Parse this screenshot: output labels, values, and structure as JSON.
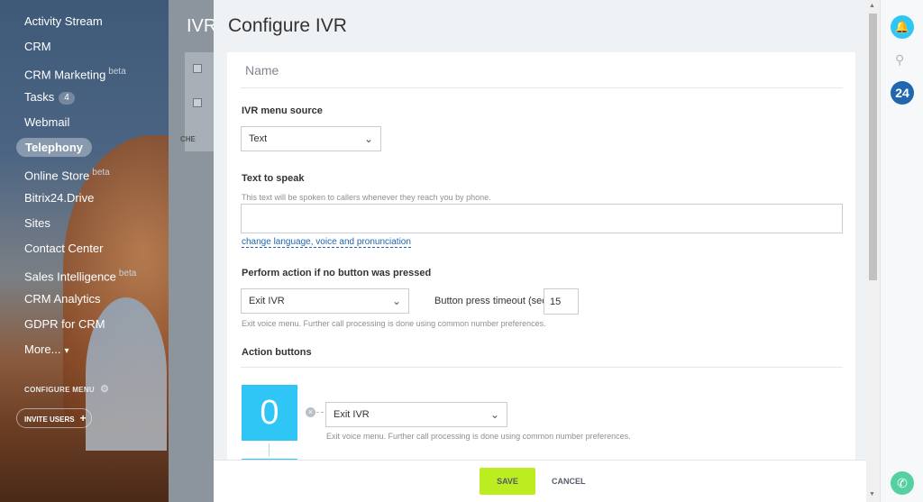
{
  "sidebar": {
    "items": [
      {
        "label": "Activity Stream",
        "beta": "",
        "count": ""
      },
      {
        "label": "CRM",
        "beta": "",
        "count": ""
      },
      {
        "label": "CRM Marketing",
        "beta": "beta",
        "count": ""
      },
      {
        "label": "Tasks",
        "beta": "",
        "count": "4"
      },
      {
        "label": "Webmail",
        "beta": "",
        "count": ""
      },
      {
        "label": "Telephony",
        "beta": "",
        "count": ""
      },
      {
        "label": "Online Store",
        "beta": "beta",
        "count": ""
      },
      {
        "label": "Bitrix24.Drive",
        "beta": "",
        "count": ""
      },
      {
        "label": "Sites",
        "beta": "",
        "count": ""
      },
      {
        "label": "Contact Center",
        "beta": "",
        "count": ""
      },
      {
        "label": "Sales Intelligence",
        "beta": "beta",
        "count": ""
      },
      {
        "label": "CRM Analytics",
        "beta": "",
        "count": ""
      },
      {
        "label": "GDPR for CRM",
        "beta": "",
        "count": ""
      },
      {
        "label": "More...",
        "beta": "",
        "count": ""
      }
    ],
    "active": "Telephony",
    "configure_menu": "CONFIGURE MENU",
    "invite_users": "INVITE USERS"
  },
  "background_page": {
    "title": "IVR",
    "footer_text": "CHE"
  },
  "panel": {
    "title": "Configure IVR",
    "name_placeholder": "Name",
    "menu_source": {
      "label": "IVR menu source",
      "value": "Text"
    },
    "text_to_speak": {
      "label": "Text to speak",
      "hint": "This text will be spoken to callers whenever they reach you by phone.",
      "value": "",
      "link": "change language, voice and pronunciation"
    },
    "no_button": {
      "label": "Perform action if no button was pressed",
      "value": "Exit IVR",
      "timeout_label": "Button press timeout (sec.):",
      "timeout_value": "15",
      "hint": "Exit voice menu. Further call processing is done using common number preferences."
    },
    "action_buttons": {
      "label": "Action buttons",
      "items": [
        {
          "digit": "0",
          "action": "Exit IVR",
          "hint": "Exit voice menu. Further call processing is done using common number preferences."
        }
      ]
    },
    "save": "SAVE",
    "cancel": "CANCEL"
  },
  "colors": {
    "accent": "#2fc6f6",
    "save_button": "#bbed21",
    "link": "#2067b0"
  },
  "icons": {
    "close": "close-icon",
    "bell": "bell-icon",
    "search": "search-icon",
    "bitrix24": "bitrix24-logo",
    "phone": "phone-icon",
    "gear": "gear-icon"
  },
  "rail": {
    "logo_text": "24"
  }
}
